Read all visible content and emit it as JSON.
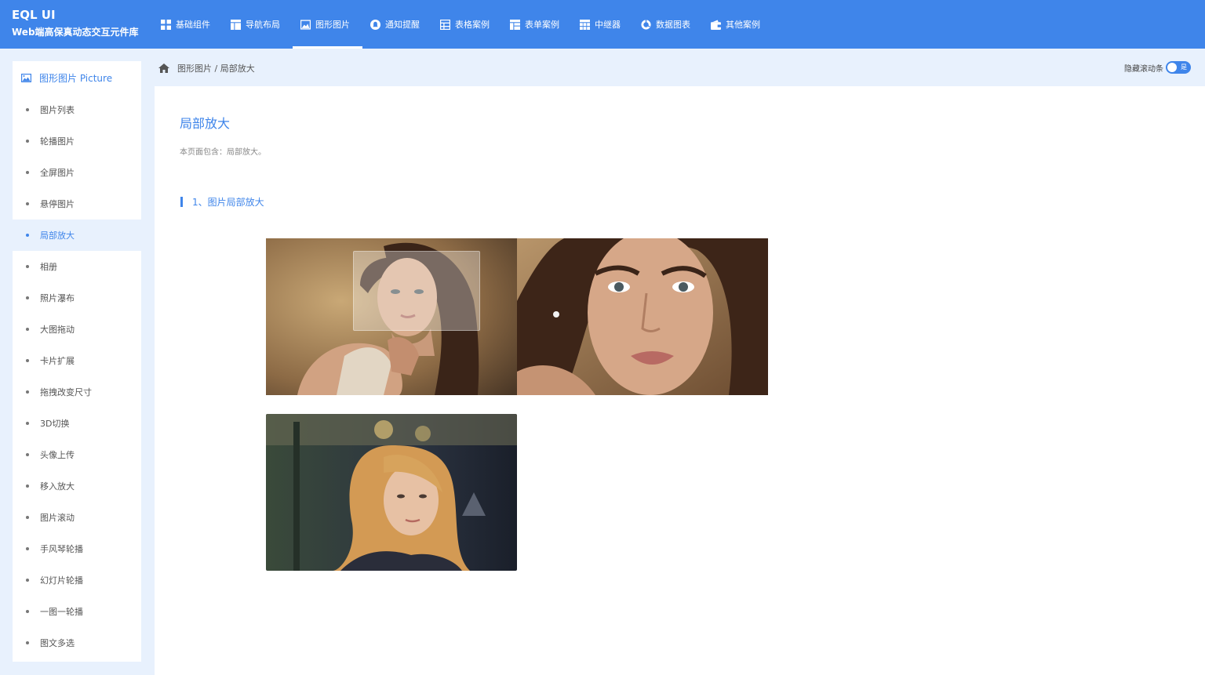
{
  "brand": {
    "title": "EQL UI",
    "subtitle": "Web端高保真动态交互元件库"
  },
  "nav": [
    {
      "label": "基础组件",
      "icon": "grid-icon"
    },
    {
      "label": "导航布局",
      "icon": "layout-icon"
    },
    {
      "label": "图形图片",
      "icon": "image-icon",
      "active": true
    },
    {
      "label": "通知提醒",
      "icon": "bell-icon"
    },
    {
      "label": "表格案例",
      "icon": "table-icon"
    },
    {
      "label": "表单案例",
      "icon": "form-icon"
    },
    {
      "label": "中继器",
      "icon": "repeater-icon"
    },
    {
      "label": "数据图表",
      "icon": "chart-icon"
    },
    {
      "label": "其他案例",
      "icon": "wallet-icon"
    }
  ],
  "sidebar": {
    "header": "图形图片 Picture",
    "header_icon": "image-icon",
    "items": [
      {
        "label": "图片列表"
      },
      {
        "label": "轮播图片"
      },
      {
        "label": "全屏图片"
      },
      {
        "label": "悬停图片"
      },
      {
        "label": "局部放大",
        "active": true
      },
      {
        "label": "相册"
      },
      {
        "label": "照片瀑布"
      },
      {
        "label": "大图拖动"
      },
      {
        "label": "卡片扩展"
      },
      {
        "label": "拖拽改变尺寸"
      },
      {
        "label": "3D切换"
      },
      {
        "label": "头像上传"
      },
      {
        "label": "移入放大"
      },
      {
        "label": "图片滚动"
      },
      {
        "label": "手风琴轮播"
      },
      {
        "label": "幻灯片轮播"
      },
      {
        "label": "一图一轮播"
      },
      {
        "label": "图文多选"
      }
    ]
  },
  "breadcrumb": {
    "text": "图形图片 / 局部放大",
    "home_icon": "home-icon"
  },
  "scroll_toggle": {
    "label": "隐藏滚动条",
    "value": "是",
    "on": true
  },
  "main": {
    "title": "局部放大",
    "description": "本页面包含：局部放大。",
    "section_title": "1、图片局部放大"
  },
  "colors": {
    "primary": "#3f85ea",
    "page_bg": "#e8f1fd"
  }
}
